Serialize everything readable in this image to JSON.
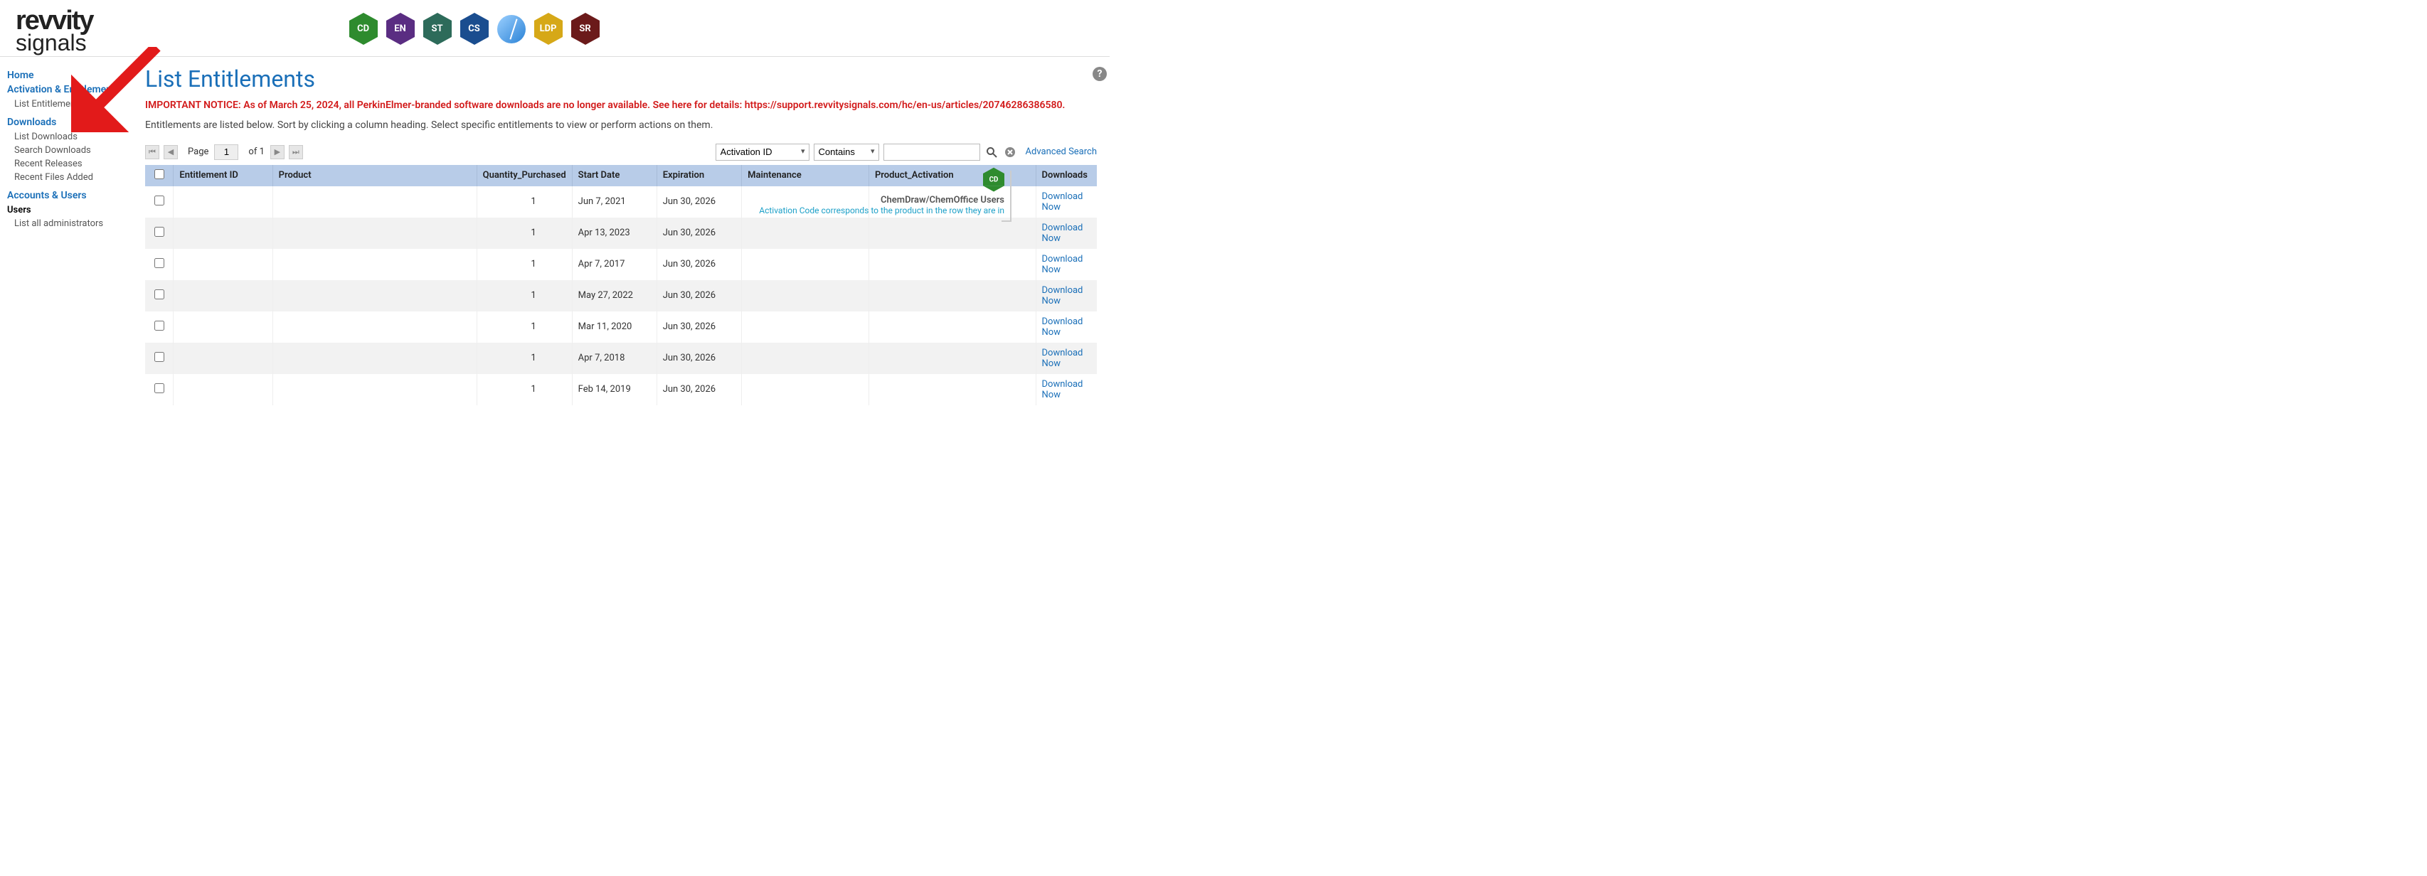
{
  "logo": {
    "top": "revvity",
    "bottom": "signals"
  },
  "badges": [
    "CD",
    "EN",
    "ST",
    "CS",
    "",
    "LDP",
    "SR"
  ],
  "nav": {
    "home": "Home",
    "activation": "Activation & Entitlements",
    "list_entitlements": "List Entitlements",
    "downloads": "Downloads",
    "list_downloads": "List Downloads",
    "search_downloads": "Search Downloads",
    "recent_releases": "Recent Releases",
    "recent_files": "Recent Files Added",
    "accounts": "Accounts & Users",
    "users": "Users",
    "list_admins": "List all administrators"
  },
  "page_title": "List Entitlements",
  "notice": "IMPORTANT NOTICE: As of March 25, 2024, all PerkinElmer-branded software downloads are no longer available. See here for details: https://support.revvitysignals.com/hc/en-us/articles/20746286386580.",
  "instructions": "Entitlements are listed below. Sort by clicking a column heading. Select specific entitlements to view or perform actions on them.",
  "annotation": {
    "badge": "CD",
    "title": "ChemDraw/ChemOffice Users",
    "sub": "Activation Code corresponds to the product in the row they are in"
  },
  "pager": {
    "page_label": "Page",
    "page_value": "1",
    "of_text": "of 1"
  },
  "filters": {
    "field_options": [
      "Activation ID"
    ],
    "field_value": "Activation ID",
    "op_options": [
      "Contains"
    ],
    "op_value": "Contains",
    "text_value": "",
    "advanced": "Advanced Search"
  },
  "columns": [
    "",
    "Entitlement ID",
    "Product",
    "Quantity_Purchased",
    "Start Date",
    "Expiration",
    "Maintenance",
    "Product_Activation",
    "Downloads"
  ],
  "rows": [
    {
      "qty": "1",
      "start": "Jun 7, 2021",
      "exp": "Jun 30, 2026",
      "dl": "Download Now"
    },
    {
      "qty": "1",
      "start": "Apr 13, 2023",
      "exp": "Jun 30, 2026",
      "dl": "Download Now"
    },
    {
      "qty": "1",
      "start": "Apr 7, 2017",
      "exp": "Jun 30, 2026",
      "dl": "Download Now"
    },
    {
      "qty": "1",
      "start": "May 27, 2022",
      "exp": "Jun 30, 2026",
      "dl": "Download Now"
    },
    {
      "qty": "1",
      "start": "Mar 11, 2020",
      "exp": "Jun 30, 2026",
      "dl": "Download Now"
    },
    {
      "qty": "1",
      "start": "Apr 7, 2018",
      "exp": "Jun 30, 2026",
      "dl": "Download Now"
    },
    {
      "qty": "1",
      "start": "Feb 14, 2019",
      "exp": "Jun 30, 2026",
      "dl": "Download Now"
    }
  ]
}
